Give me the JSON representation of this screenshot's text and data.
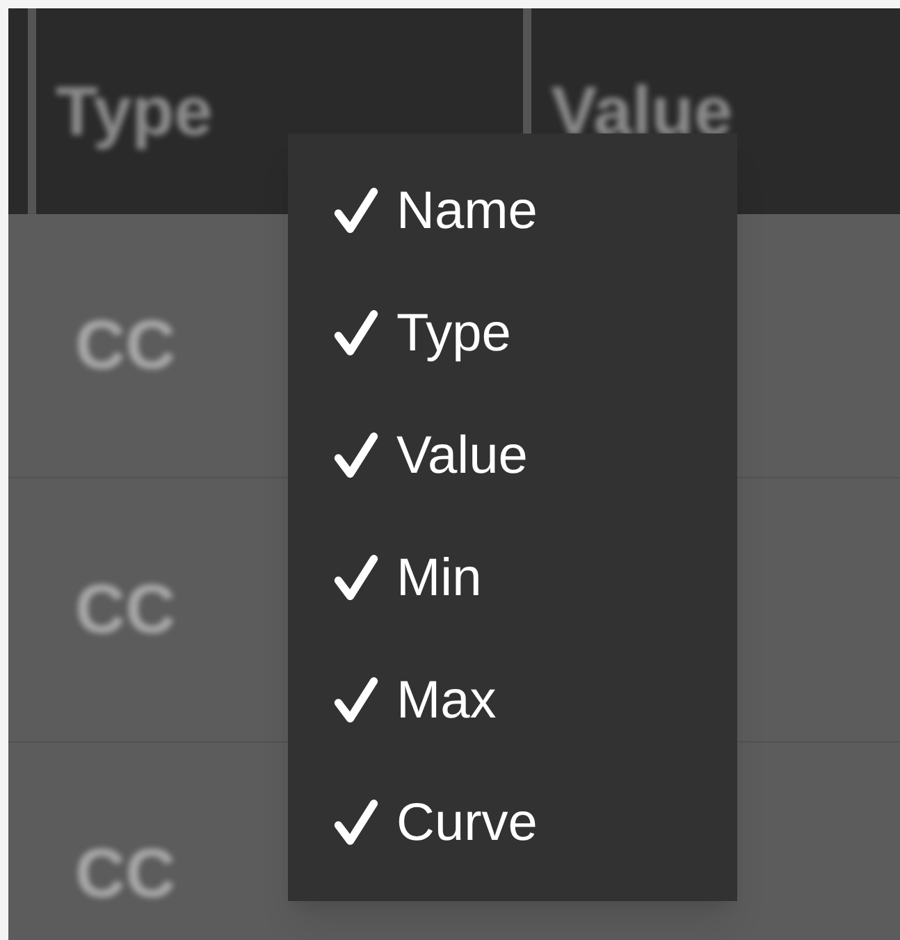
{
  "table": {
    "columns": [
      "Type",
      "Value"
    ],
    "rows": [
      {
        "type": "CC"
      },
      {
        "type": "CC"
      },
      {
        "type": "CC"
      }
    ]
  },
  "column_menu": {
    "items": [
      {
        "label": "Name",
        "checked": true
      },
      {
        "label": "Type",
        "checked": true
      },
      {
        "label": "Value",
        "checked": true
      },
      {
        "label": "Min",
        "checked": true
      },
      {
        "label": "Max",
        "checked": true
      },
      {
        "label": "Curve",
        "checked": true
      }
    ]
  }
}
